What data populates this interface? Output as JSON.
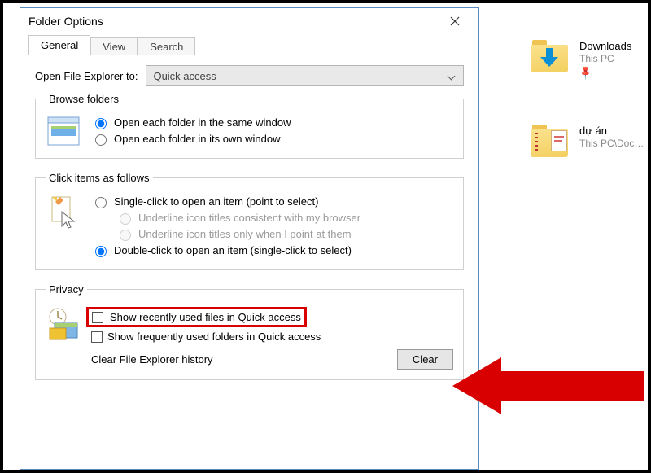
{
  "dialog": {
    "title": "Folder Options",
    "tabs": {
      "general": "General",
      "view": "View",
      "search": "Search"
    },
    "open_to": {
      "label": "Open File Explorer to:",
      "value": "Quick access"
    },
    "browse": {
      "legend": "Browse folders",
      "same": "Open each folder in the same window",
      "own": "Open each folder in its own window"
    },
    "click": {
      "legend": "Click items as follows",
      "single": "Single-click to open an item (point to select)",
      "under_always": "Underline icon titles consistent with my browser",
      "under_hover": "Underline icon titles only when I point at them",
      "double": "Double-click to open an item (single-click to select)"
    },
    "privacy": {
      "legend": "Privacy",
      "recent": "Show recently used files in Quick access",
      "frequent": "Show frequently used folders in Quick access",
      "clear_label": "Clear File Explorer history",
      "clear_button": "Clear"
    }
  },
  "bg": {
    "downloads": {
      "name": "Downloads",
      "sub": "This PC"
    },
    "project": {
      "name": "dự án",
      "sub": "This PC\\Doc…"
    }
  }
}
